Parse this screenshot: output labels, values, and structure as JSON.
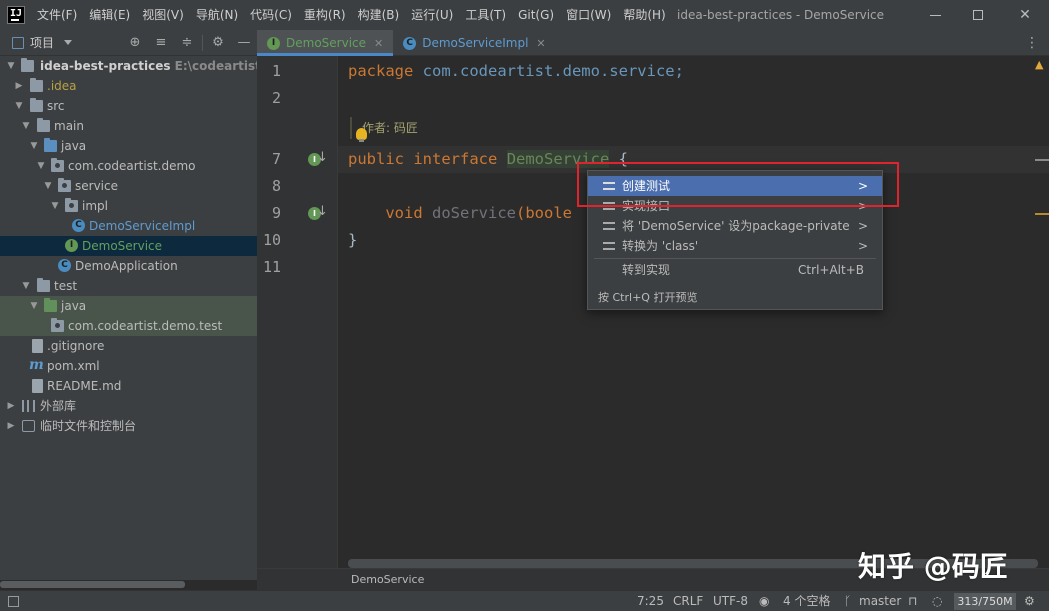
{
  "titlebar": {
    "menu": [
      "文件(F)",
      "编辑(E)",
      "视图(V)",
      "导航(N)",
      "代码(C)",
      "重构(R)",
      "构建(B)",
      "运行(U)",
      "工具(T)",
      "Git(G)",
      "窗口(W)",
      "帮助(H)"
    ],
    "window_title": "idea-best-practices - DemoService",
    "logo": "IJ"
  },
  "project_panel": {
    "title": "项目",
    "tree": [
      {
        "label": "idea-best-practices",
        "path": "E:\\codeartist\\ide",
        "icon": "folder-icon"
      },
      {
        "label": ".idea",
        "icon": "folder-icon"
      },
      {
        "label": "src",
        "icon": "folder-icon"
      },
      {
        "label": "main",
        "icon": "folder-icon"
      },
      {
        "label": "java",
        "icon": "source-folder-icon"
      },
      {
        "label": "com.codeartist.demo",
        "icon": "package-icon"
      },
      {
        "label": "service",
        "icon": "package-icon"
      },
      {
        "label": "impl",
        "icon": "package-icon"
      },
      {
        "label": "DemoServiceImpl",
        "icon": "class-icon"
      },
      {
        "label": "DemoService",
        "icon": "interface-icon"
      },
      {
        "label": "DemoApplication",
        "icon": "class-icon"
      },
      {
        "label": "test",
        "icon": "folder-icon"
      },
      {
        "label": "java",
        "icon": "test-folder-icon"
      },
      {
        "label": "com.codeartist.demo.test",
        "icon": "package-icon"
      },
      {
        "label": ".gitignore",
        "icon": "file-icon"
      },
      {
        "label": "pom.xml",
        "icon": "maven-icon"
      },
      {
        "label": "README.md",
        "icon": "markdown-icon"
      },
      {
        "label": "外部库",
        "icon": "library-icon"
      },
      {
        "label": "临时文件和控制台",
        "icon": "scratch-icon"
      }
    ]
  },
  "tabs": [
    {
      "label": "DemoService",
      "icon": "I",
      "active": true
    },
    {
      "label": "DemoServiceImpl",
      "icon": "C",
      "active": false
    }
  ],
  "editor": {
    "line_numbers": [
      "1",
      "2",
      "7",
      "8",
      "9",
      "10",
      "11"
    ],
    "code": {
      "l1_kw": "package",
      "l1_rest": " com.codeartist.demo.service;",
      "author": "作者: 码匠",
      "l7_kw1": "public",
      "l7_kw2": "interface",
      "l7_name": "DemoService",
      "l7_brace": " {",
      "l9_kw": "void",
      "l9_method": "doService",
      "l9_rest": "(boole",
      "l10": "}"
    },
    "breadcrumb": "DemoService"
  },
  "popup": {
    "items": [
      {
        "label": "创建测试",
        "submenu": true,
        "active": true
      },
      {
        "label": "实现接口",
        "submenu": true
      },
      {
        "label": "将 'DemoService' 设为package-private",
        "submenu": true
      },
      {
        "label": "转换为 'class'",
        "submenu": true
      }
    ],
    "goto": {
      "label": "转到实现",
      "shortcut": "Ctrl+Alt+B"
    },
    "footer": "按 Ctrl+Q 打开预览"
  },
  "statusbar": {
    "position": "7:25",
    "line_sep": "CRLF",
    "encoding": "UTF-8",
    "indent": "4 个空格",
    "branch": "master",
    "memory": "313/750M"
  },
  "watermark": "知乎 @码匠",
  "colors": {
    "accent": "#4b6eaf",
    "highlight_box": "#e0232c",
    "interface": "#62a05f",
    "class": "#5e9bd0"
  }
}
